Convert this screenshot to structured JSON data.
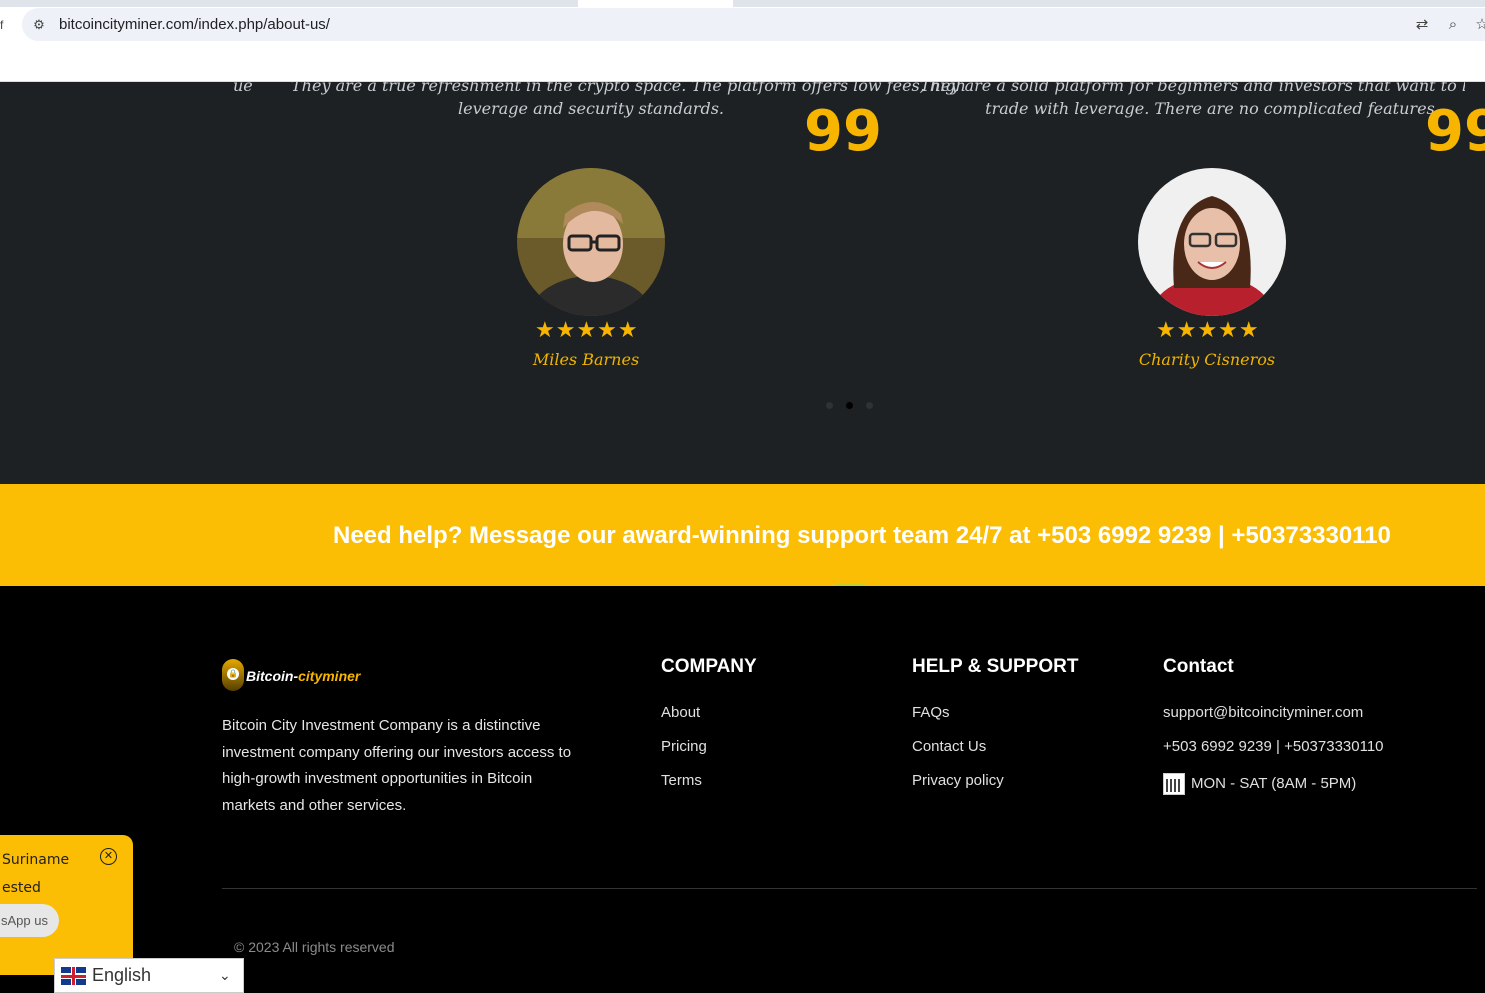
{
  "browser": {
    "url": "bitcoincityminer.com/index.php/about-us/",
    "tab_edge_glyph": "f"
  },
  "testimonials": {
    "items": [
      {
        "quote_left_fragment": "ue",
        "quote_line1": "They are a true refreshment in the crypto space. The platform offers low fees, high",
        "quote_line2": "leverage and security standards.",
        "stars": "★★★★★",
        "name": "Miles Barnes"
      },
      {
        "quote_line1": "They are  a solid platform for beginners and investors that want to learn how",
        "quote_line2": "trade with leverage. There are no complicated features.",
        "stars": "★★★★★",
        "name": "Charity Cisneros"
      }
    ],
    "quote_mark": "99",
    "active_dot": 1
  },
  "help_banner": {
    "text": "Need help? Message our award-winning support team 24/7 at +503 6992 9239 | +50373330110"
  },
  "footer": {
    "logo": {
      "part1": "Bitcoin-",
      "part2": "cityminer"
    },
    "about": "Bitcoin City Investment Company is a distinctive investment company offering our investors access to high-growth investment opportunities in Bitcoin markets and other services.",
    "company": {
      "title": "COMPANY",
      "links": [
        "About",
        "Pricing",
        "Terms"
      ]
    },
    "help": {
      "title": "HELP & SUPPORT",
      "links": [
        "FAQs",
        "Contact Us",
        "Privacy policy"
      ]
    },
    "contact": {
      "title": "Contact",
      "email": "support@bitcoincityminer.com",
      "phone": "+503 6992 9239 | +50373330110",
      "hours": "MON - SAT (8AM - 5PM)"
    },
    "copyright": "© 2023 All rights reserved"
  },
  "popup": {
    "line1": "Suriname",
    "line2": "ested",
    "button": "sApp us"
  },
  "language": {
    "selected": "English"
  },
  "colors": {
    "accent": "#fcbd05",
    "dark_bg": "#1d2124",
    "footer_bg": "#000000"
  }
}
